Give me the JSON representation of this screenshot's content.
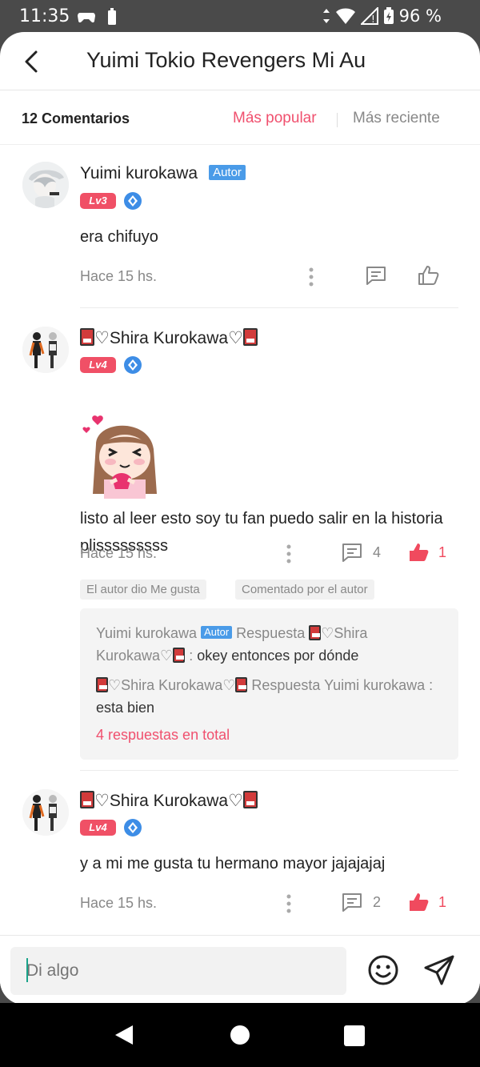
{
  "status_bar": {
    "time": "11:35",
    "battery": "96 %"
  },
  "header": {
    "title": "Yuimi Tokio Revengers Mi Au"
  },
  "sortbar": {
    "count": "12 Comentarios",
    "popular": "Más popular",
    "recent": "Más reciente"
  },
  "comments": [
    {
      "name": "Yuimi kurokawa",
      "author_tag": "Autor",
      "level": "Lv3",
      "text": "era chifuyo",
      "time": "Hace 15 hs."
    },
    {
      "name": "♡Shira Kurokawa♡",
      "level": "Lv4",
      "text": "listo al leer esto soy tu fan puedo salir en la historia plisssssssss",
      "time": "Hace 15 hs.",
      "reply_count": "4",
      "like_count": "1",
      "chips": [
        "El autor dio Me gusta",
        "Comentado por el autor"
      ],
      "replies": [
        {
          "author": "Yuimi kurokawa",
          "author_tag": "Autor",
          "verb": "Respuesta",
          "target": "♡Shira Kurokawa♡",
          "separator": " : ",
          "text": "okey entonces por dónde"
        },
        {
          "author": "♡Shira Kurokawa♡",
          "verb": "Respuesta",
          "target": "Yuimi kurokawa",
          "separator": " : ",
          "text": "esta bien"
        }
      ],
      "total_replies": "4 respuestas en total"
    },
    {
      "name": "♡Shira Kurokawa♡",
      "level": "Lv4",
      "text": "y a mi me gusta tu hermano mayor jajajajaj",
      "time": "Hace 15 hs.",
      "reply_count": "2",
      "like_count": "1"
    }
  ],
  "composer": {
    "placeholder": "Di algo"
  },
  "colors": {
    "accent": "#f0506e",
    "author_tag": "#4a9be8",
    "level_badge": "#f05066",
    "like": "#f04a5e"
  }
}
